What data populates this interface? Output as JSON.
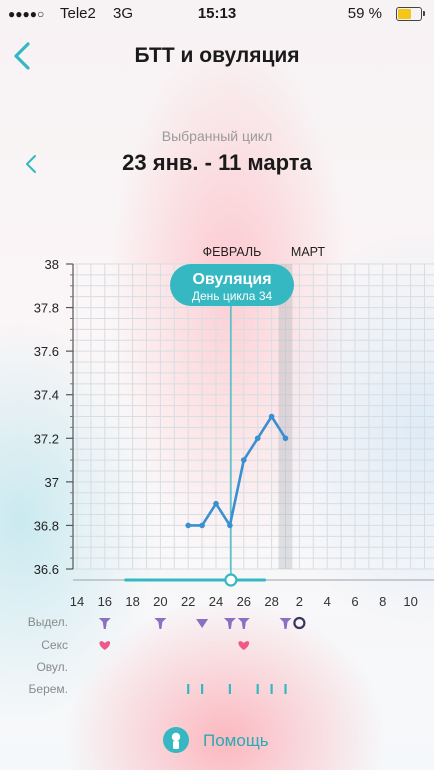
{
  "status_bar": {
    "signal": "●●●●○",
    "carrier": "Tele2",
    "network": "3G",
    "time": "15:13",
    "battery_percent": "59 %",
    "battery_level": 0.59
  },
  "nav": {
    "back_icon": "chevron-left-icon",
    "title": "БТТ и овуляция"
  },
  "cycle": {
    "caption": "Выбранный цикл",
    "range": "23 янв. - 11 марта",
    "prev_icon": "chevron-left-icon"
  },
  "colors": {
    "accent": "#35b8c2",
    "line": "#3a8fd0",
    "discharge": "#8a6fc2",
    "heart": "#f0588a"
  },
  "chart_data": {
    "type": "line",
    "month_labels": [
      {
        "label": "ФЕВРАЛЬ",
        "x": 25
      },
      {
        "label": "МАРТ",
        "x": 30
      }
    ],
    "ylim": [
      36.6,
      38
    ],
    "y_ticks": [
      "38",
      "37.8",
      "37.6",
      "37.4",
      "37.2",
      "37",
      "36.8",
      "36.6"
    ],
    "x_ticks": [
      "14",
      "16",
      "18",
      "20",
      "22",
      "24",
      "26",
      "28",
      "2",
      "4",
      "6",
      "8",
      "10"
    ],
    "x": [
      22,
      23,
      24,
      25,
      26,
      27,
      28,
      29
    ],
    "values": [
      36.8,
      36.8,
      36.9,
      36.8,
      37.1,
      37.2,
      37.3,
      37.2
    ],
    "ovulation": {
      "title": "Овуляция",
      "subtitle": "День цикла 34",
      "x": 25
    },
    "today_x": 29,
    "scroller_range": [
      17.5,
      27.5
    ],
    "scroller_value": 25
  },
  "rows": [
    {
      "label": "Выдел.",
      "key": "discharge",
      "marks": [
        {
          "x": 16,
          "icon": "drop-cluster-icon"
        },
        {
          "x": 20,
          "icon": "drop-cluster-icon"
        },
        {
          "x": 23,
          "icon": "diamond-drop-icon"
        },
        {
          "x": 25,
          "icon": "drop-cluster-icon"
        },
        {
          "x": 26,
          "icon": "drop-cluster-icon"
        },
        {
          "x": 29,
          "icon": "drop-cluster-icon"
        },
        {
          "x": 30,
          "icon": "ring-icon"
        }
      ]
    },
    {
      "label": "Секс",
      "key": "sex",
      "marks": [
        {
          "x": 16,
          "icon": "heart-icon"
        },
        {
          "x": 26,
          "icon": "heart-icon"
        }
      ]
    },
    {
      "label": "Овул.",
      "key": "ovulation_test",
      "marks": []
    },
    {
      "label": "Берем.",
      "key": "pregnancy_test",
      "marks": [
        {
          "x": 22,
          "icon": "tick-icon"
        },
        {
          "x": 23,
          "icon": "tick-icon"
        },
        {
          "x": 25,
          "icon": "tick-icon"
        },
        {
          "x": 27,
          "icon": "tick-icon"
        },
        {
          "x": 28,
          "icon": "tick-icon"
        },
        {
          "x": 29,
          "icon": "tick-icon"
        }
      ]
    }
  ],
  "help": {
    "label": "Помощь",
    "icon": "help-icon"
  }
}
